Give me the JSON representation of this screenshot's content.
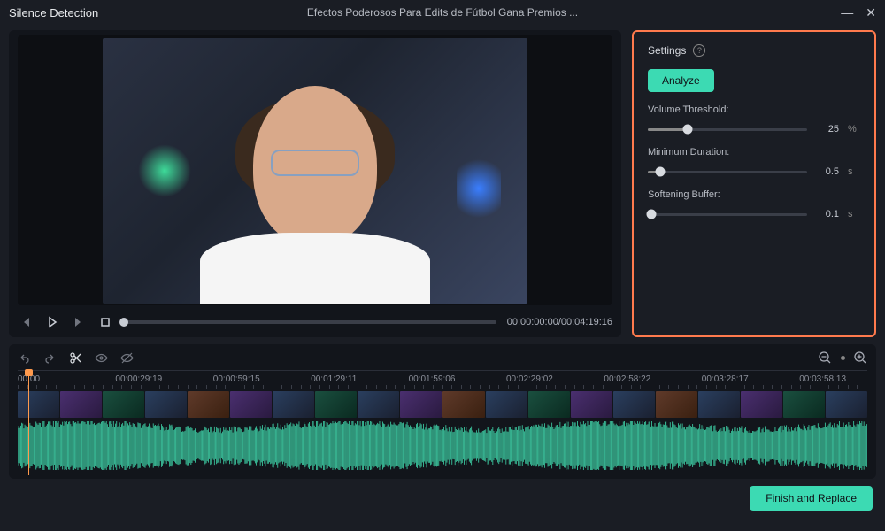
{
  "titlebar": {
    "title": "Silence Detection",
    "project": "Efectos Poderosos Para Edits de Fútbol   Gana Premios ..."
  },
  "playback": {
    "timecode": "00:00:00:00/00:04:19:16"
  },
  "settings": {
    "header": "Settings",
    "analyze_label": "Analyze",
    "volume_threshold": {
      "label": "Volume Threshold:",
      "value": "25",
      "unit": "%",
      "percent": 25
    },
    "minimum_duration": {
      "label": "Minimum Duration:",
      "value": "0.5",
      "unit": "s",
      "percent": 8
    },
    "softening_buffer": {
      "label": "Softening Buffer:",
      "value": "0.1",
      "unit": "s",
      "percent": 2
    }
  },
  "timeline": {
    "labels": [
      "00:00",
      "00:00:29:19",
      "00:00:59:15",
      "00:01:29:11",
      "00:01:59:06",
      "00:02:29:02",
      "00:02:58:22",
      "00:03:28:17",
      "00:03:58:13"
    ]
  },
  "footer": {
    "finish_label": "Finish and Replace"
  }
}
